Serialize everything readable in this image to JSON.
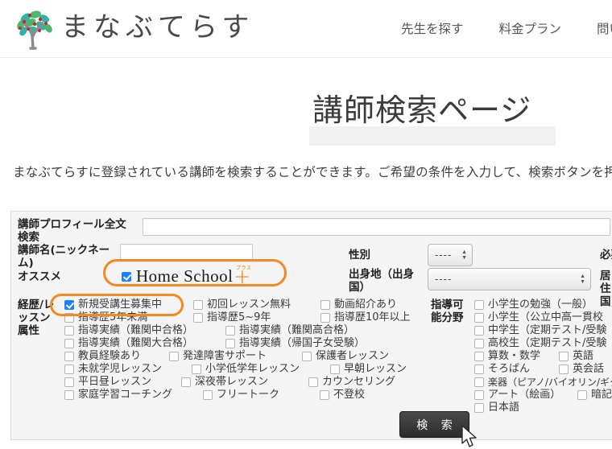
{
  "header": {
    "logo_text": "まなぶてらす",
    "logo_icon": "tree-logo-icon",
    "nav": [
      {
        "label": "先生を探す"
      },
      {
        "label": "料金プラン"
      },
      {
        "label": "問い"
      }
    ]
  },
  "page": {
    "title": "講師検索ページ",
    "lead": "まなぶてらすに登録されている講師を検索することができます。ご希望の条件を入力して、検索ボタンを押"
  },
  "form": {
    "fulltext": {
      "label_line1": "講師プロフィール全文",
      "label_line2": "検索",
      "value": "",
      "placeholder": ""
    },
    "nickname": {
      "label_line1": "講師名(ニックネー",
      "label_line2": "ム)",
      "value": "",
      "placeholder": ""
    },
    "recommend": {
      "label": "オススメ",
      "checked": true,
      "logo_main": "Home School",
      "logo_plus": "+",
      "logo_kana": "プラス"
    },
    "gender": {
      "label": "性別",
      "value": "----"
    },
    "birthplace": {
      "label_line1": "出身地（出身",
      "label_line2": "国）",
      "value": "----"
    },
    "required_clipped": "必要",
    "residence_clipped_line1": "居住",
    "residence_clipped_line2": "国)",
    "attributes": {
      "label_line1": "経歴/レ",
      "label_line2": "ッスン",
      "label_line3": "属性",
      "rows": [
        [
          {
            "label": "新規受講生募集中",
            "checked": true,
            "highlight": true
          },
          {
            "label": "初回レッスン無料",
            "checked": false
          },
          {
            "label": "動画紹介あり",
            "checked": false
          }
        ],
        [
          {
            "label": "指導歴5年未満",
            "checked": false
          },
          {
            "label": "指導歴5~9年",
            "checked": false
          },
          {
            "label": "指導歴10年以上",
            "checked": false
          }
        ],
        [
          {
            "label": "指導実績（難関中合格）",
            "checked": false
          },
          {
            "label": "指導実績（難関高合格）",
            "checked": false
          }
        ],
        [
          {
            "label": "指導実績（難関大合格）",
            "checked": false
          },
          {
            "label": "指導実績（帰国子女受験）",
            "checked": false
          }
        ],
        [
          {
            "label": "教員経験あり",
            "checked": false
          },
          {
            "label": "発達障害サポート",
            "checked": false
          },
          {
            "label": "保護者レッスン",
            "checked": false
          }
        ],
        [
          {
            "label": "未就学児レッスン",
            "checked": false
          },
          {
            "label": "小学低学年レッスン",
            "checked": false
          },
          {
            "label": "早朝レッスン",
            "checked": false
          }
        ],
        [
          {
            "label": "平日昼レッスン",
            "checked": false
          },
          {
            "label": "深夜帯レッスン",
            "checked": false
          },
          {
            "label": "カウンセリング",
            "checked": false
          }
        ],
        [
          {
            "label": "家庭学習コーチング",
            "checked": false
          },
          {
            "label": "フリートーク",
            "checked": false
          },
          {
            "label": "不登校",
            "checked": false
          }
        ]
      ]
    },
    "subjects": {
      "label_line1": "指導可",
      "label_line2": "能分野",
      "rows": [
        [
          {
            "label": "小学生の勉強（一般）",
            "checked": false
          }
        ],
        [
          {
            "label": "小学生（公立中高一貫校",
            "checked": false
          }
        ],
        [
          {
            "label": "中学生（定期テスト/受験",
            "checked": false
          }
        ],
        [
          {
            "label": "高校生（定期テスト/受験",
            "checked": false
          }
        ],
        [
          {
            "label": "算数・数学",
            "checked": false
          },
          {
            "label": "英語",
            "checked": false
          },
          {
            "label": "",
            "checked": false
          }
        ],
        [
          {
            "label": "そろばん",
            "checked": false
          },
          {
            "label": "英会話",
            "checked": false
          },
          {
            "label": "",
            "checked": false
          }
        ],
        [
          {
            "label": "楽器（ピアノ/バイオリン/ギター",
            "checked": false
          }
        ],
        [
          {
            "label": "アート（絵画）",
            "checked": false
          },
          {
            "label": "暗記",
            "checked": false
          }
        ],
        [
          {
            "label": "日本語",
            "checked": false
          }
        ]
      ]
    }
  },
  "actions": {
    "search_button": "検 索"
  },
  "colors": {
    "highlight": "#f5881f",
    "checkbox_checked": "#1a82ff",
    "panel_bg": "#f4f4f4",
    "button_bg": "#2c2c2c"
  }
}
